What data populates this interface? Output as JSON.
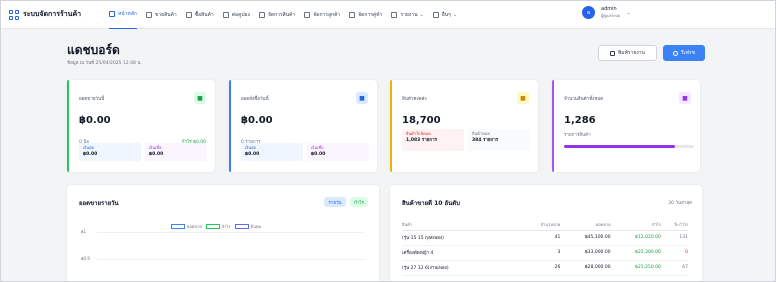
{
  "nav": {
    "title": "ระบบจัดการร้านค้า",
    "items": [
      {
        "label": "หน้าหลัก",
        "icon": "home-icon",
        "active": true
      },
      {
        "label": "ขายสินค้า",
        "icon": "cart-icon"
      },
      {
        "label": "ซื้อสินค้า",
        "icon": "bag-icon"
      },
      {
        "label": "ต่อคูปอง",
        "icon": "coupon-icon"
      },
      {
        "label": "จัดการสินค้า",
        "icon": "box-icon"
      },
      {
        "label": "จัดการลูกค้า",
        "icon": "users-icon"
      },
      {
        "label": "จัดการคู่ค้า",
        "icon": "store-icon"
      },
      {
        "label": "รายงาน",
        "icon": "report-icon",
        "dropdown": true
      },
      {
        "label": "อื่นๆ",
        "icon": "menu-icon",
        "dropdown": true
      }
    ],
    "user": {
      "initial": "a",
      "name": "admin",
      "role": "ผู้ดูแลระบบ"
    }
  },
  "header": {
    "title": "แดชบอร์ด",
    "subtitle": "ข้อมูล ณ วันที่ 25/04/2025 12:48 น.",
    "print_label": "พิมพ์รายงาน",
    "refresh_label": "รีเฟรช"
  },
  "cards": [
    {
      "label": "ยอดขายวันนี้",
      "value": "฿0.00",
      "meta": "0 บิล",
      "meta_right": "กำไร ฿0.00",
      "accent": "#22c55e",
      "icon_bg": "#dcfce7",
      "icon_color": "#16a34a",
      "pills": [
        {
          "label": "เงินสด",
          "value": "฿0.00",
          "bg": "#eff6ff",
          "color": "#2563eb"
        },
        {
          "label": "เงินเชื่อ",
          "value": "฿0.00",
          "bg": "#faf5ff",
          "color": "#9333ea"
        }
      ]
    },
    {
      "label": "ยอดสั่งซื้อวันนี้",
      "value": "฿0.00",
      "meta": "0 รายการ",
      "accent": "#3b82f6",
      "icon_bg": "#dbeafe",
      "icon_color": "#2563eb",
      "pills": [
        {
          "label": "เงินสด",
          "value": "฿0.00",
          "bg": "#eff6ff",
          "color": "#2563eb"
        },
        {
          "label": "เงินเชื่อ",
          "value": "฿0.00",
          "bg": "#faf5ff",
          "color": "#9333ea"
        }
      ]
    },
    {
      "label": "สินค้าคงคลัง",
      "value": "18,700",
      "accent": "#eab308",
      "icon_bg": "#fef9c3",
      "icon_color": "#ca8a04",
      "pills": [
        {
          "label": "สินค้าใกล้หมด",
          "value": "1,083 รายการ",
          "bg": "#fef2f2",
          "color": "#dc2626"
        },
        {
          "label": "สินค้าหมด",
          "value": "384 รายการ",
          "bg": "#f9fafb",
          "color": "#6b7280"
        }
      ]
    },
    {
      "label": "จำนวนสินค้าทั้งหมด",
      "value": "1,286",
      "meta": "รายการสินค้า",
      "accent": "#a855f7",
      "icon_bg": "#f3e8ff",
      "icon_color": "#9333ea",
      "progress": 0.85
    }
  ],
  "daily_sales": {
    "title": "ยอดขายรายวัน",
    "toggle_daily": "รายวัน",
    "toggle_profit": "กำไร",
    "legend": [
      {
        "name": "ยอดขาย",
        "color": "#3b82f6"
      },
      {
        "name": "กำไร",
        "color": "#22c55e"
      },
      {
        "name": "ต้นทุน",
        "color": "#6366f1"
      }
    ],
    "yticks": [
      "฿1",
      "฿0.9"
    ]
  },
  "top_products": {
    "title": "สินค้าขายดี 10 อันดับ",
    "subtitle": "30 วันล่าสุด",
    "columns": [
      "สินค้า",
      "จำนวนขาย",
      "ยอดขาย",
      "กำไร",
      "% กำไร"
    ],
    "rows": [
      {
        "name": "(รุ่น 15 15 ถุงสเพลง)",
        "qty": "41",
        "sales": "฿45,100.00",
        "profit": "฿12,020.00",
        "margin": "131"
      },
      {
        "name": "เครื่องตัดหญ้า 4",
        "qty": "3",
        "sales": "฿33,000.00",
        "profit": "฿22,300.00",
        "margin": "0"
      },
      {
        "name": "(รุ่น 27 12 6(งานเพลง)",
        "qty": "26",
        "sales": "฿28,000.00",
        "profit": "฿21,250.00",
        "margin": "67"
      }
    ]
  }
}
